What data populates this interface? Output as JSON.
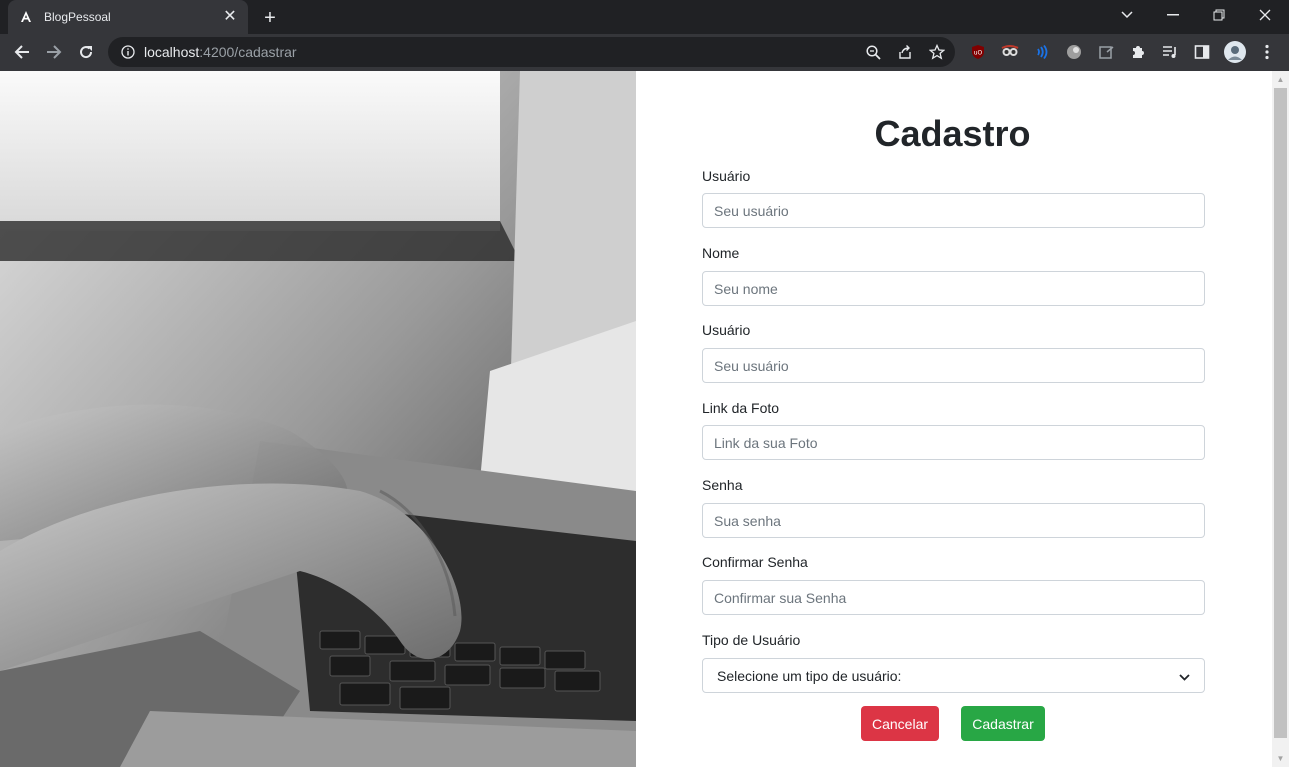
{
  "browser": {
    "tab_title": "BlogPessoal",
    "url_host": "localhost",
    "url_path": ":4200/cadastrar"
  },
  "form": {
    "title": "Cadastro",
    "fields": [
      {
        "label": "Usuário",
        "placeholder": "Seu usuário"
      },
      {
        "label": "Nome",
        "placeholder": "Seu nome"
      },
      {
        "label": "Usuário",
        "placeholder": "Seu usuário"
      },
      {
        "label": "Link da Foto",
        "placeholder": "Link da sua Foto"
      },
      {
        "label": "Senha",
        "placeholder": "Sua senha"
      },
      {
        "label": "Confirmar Senha",
        "placeholder": "Confirmar sua Senha"
      }
    ],
    "select": {
      "label": "Tipo de Usuário",
      "value": "Selecione um tipo de usuário:"
    },
    "cancel_label": "Cancelar",
    "submit_label": "Cadastrar"
  },
  "colors": {
    "cancel": "#dc3545",
    "submit": "#28a745",
    "chrome_dark": "#202124",
    "chrome_toolbar": "#35363a"
  }
}
